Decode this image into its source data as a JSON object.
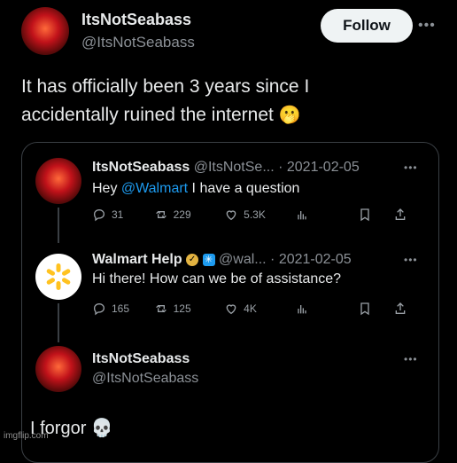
{
  "post": {
    "author_name": "ItsNotSeabass",
    "author_handle": "@ItsNotSeabass",
    "follow_label": "Follow",
    "more_icon": "•••",
    "text_line1": "It has officially been 3 years since I",
    "text_line2": "accidentally ruined the internet",
    "emoji": "🫢"
  },
  "thread": [
    {
      "author_name": "ItsNotSeabass",
      "meta": "@ItsNotSe... · 2021-02-05",
      "text_prefix": "Hey ",
      "mention": "@Walmart",
      "text_suffix": " I have a question",
      "replies": "31",
      "retweets": "229",
      "likes": "5.3K"
    },
    {
      "author_name": "Walmart Help",
      "meta": "@wal... · 2021-02-05",
      "text": "Hi there! How can we be of assistance?",
      "replies": "165",
      "retweets": "125",
      "likes": "4K"
    },
    {
      "author_name": "ItsNotSeabass",
      "author_handle": "@ItsNotSeabass",
      "text": "I forgor",
      "emoji": "💀"
    }
  ],
  "watermark": "imgflip.com",
  "colors": {
    "background": "#000000",
    "text": "#e7e9ea",
    "muted": "#8b9096",
    "mention": "#1d9bf0",
    "walmart_yellow": "#ffc220"
  }
}
